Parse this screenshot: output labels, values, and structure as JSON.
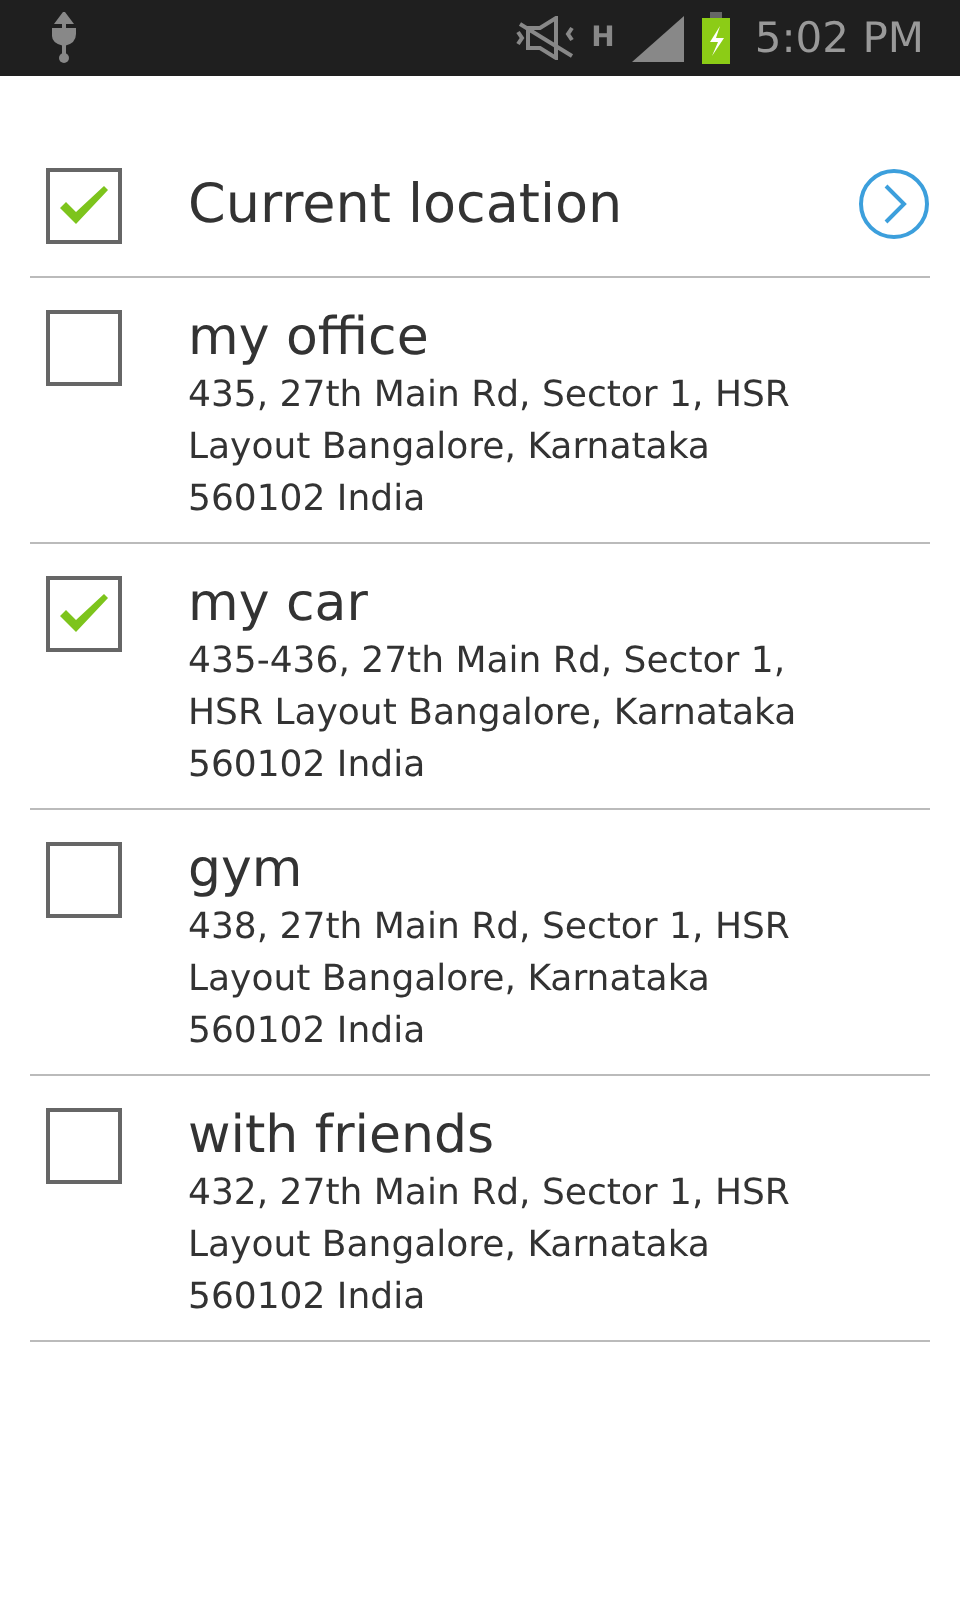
{
  "status_bar": {
    "network_type": "H",
    "battery_charging": true,
    "time": "5:02 PM"
  },
  "current_location": {
    "label": "Current location",
    "checked": true
  },
  "places": [
    {
      "name": "my office",
      "address": "435, 27th Main Rd, Sector 1, HSR Layout Bangalore, Karnataka 560102 India",
      "checked": false
    },
    {
      "name": "my car",
      "address": "435-436, 27th Main Rd, Sector 1, HSR Layout Bangalore, Karnataka 560102 India",
      "checked": true
    },
    {
      "name": "gym",
      "address": "438, 27th Main Rd, Sector 1, HSR Layout Bangalore, Karnataka 560102 India",
      "checked": false
    },
    {
      "name": "with friends",
      "address": "432, 27th Main Rd, Sector 1, HSR Layout Bangalore, Karnataka 560102 India",
      "checked": false
    }
  ]
}
